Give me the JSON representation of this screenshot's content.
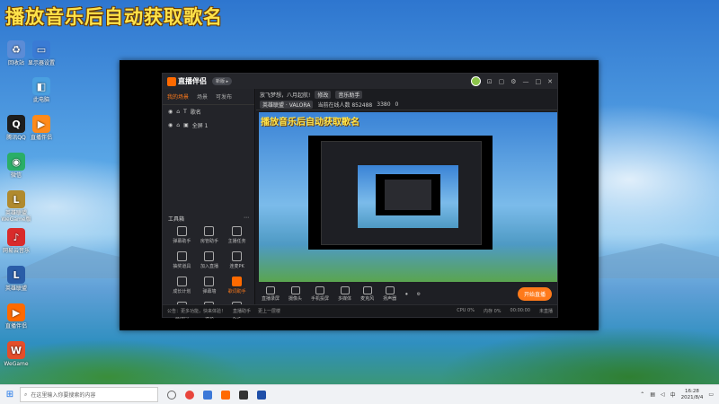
{
  "headline": "播放音乐后自动获取歌名",
  "desktop_icons": [
    {
      "label": "回收站",
      "icon": "recycle-icon",
      "color": "#5b8cd6"
    },
    {
      "label": "腾讯QQ",
      "icon": "qq-icon",
      "color": "#1e1e1e"
    },
    {
      "label": "微信",
      "icon": "wechat-icon",
      "color": "#2aae67"
    },
    {
      "label": "英雄联盟 WeGame版",
      "icon": "lol-icon",
      "color": "#b08a2e"
    },
    {
      "label": "网易云音乐",
      "icon": "netease-music-icon",
      "color": "#d92b2b"
    },
    {
      "label": "英雄联盟",
      "icon": "lol-icon-2",
      "color": "#2a5da8"
    },
    {
      "label": "直播伴侣",
      "icon": "live-companion-icon",
      "color": "#ff6a00"
    },
    {
      "label": "WeGame",
      "icon": "wegame-icon",
      "color": "#e44e2a"
    }
  ],
  "desktop_icons_col2": [
    {
      "label": "显示器设置",
      "icon": "display-icon",
      "color": "#3a7bd5"
    },
    {
      "label": "此电脑",
      "icon": "computer-icon",
      "color": "#4aa0e0"
    },
    {
      "label": "直播伴侣",
      "icon": "live-companion-icon-2",
      "color": "#ff8a1a"
    }
  ],
  "app": {
    "logo": "直播伴侣",
    "version": "新版 ▸",
    "tabs": [
      "我的场景",
      "场景",
      "可发布"
    ],
    "scene_items": [
      "歌名",
      "全屏 1"
    ],
    "tools_header": "工具箱",
    "tools": [
      {
        "label": "弹幕助手",
        "hot": false
      },
      {
        "label": "房管助手",
        "hot": false
      },
      {
        "label": "主播任务",
        "hot": false
      },
      {
        "label": "抽奖道具",
        "hot": false
      },
      {
        "label": "加入直播",
        "hot": false
      },
      {
        "label": "连麦PK",
        "hot": false
      },
      {
        "label": "成长计划",
        "hot": false
      },
      {
        "label": "弹幕墙",
        "hot": false
      },
      {
        "label": "歌词助手",
        "hot": true
      },
      {
        "label": "直播间",
        "hot": false
      },
      {
        "label": "模板",
        "hot": false
      },
      {
        "label": "更多",
        "hot": false
      }
    ],
    "info": {
      "title": "放飞梦想，八月起航!",
      "edit_label": "修改",
      "category": "音乐助手",
      "row2": [
        "英雄联盟 · VALORA",
        "当前在线人数 852488",
        "3380",
        "0"
      ]
    },
    "preview_title": "播放音乐后自动获取歌名",
    "bottom_buttons": [
      "直播录屏",
      "摄像头",
      "手机投屏",
      "多媒体",
      "麦克风",
      "扬声器"
    ],
    "start_button": "开始直播",
    "status_left": [
      "公告：更多功能，快来体验！",
      "直播助手",
      "更上一层楼"
    ],
    "status_right": [
      "CPU 0%",
      "内存 0%",
      "00:00:00",
      "未直播"
    ]
  },
  "taskbar": {
    "search_placeholder": "在这里输入你要搜索的内容",
    "time": "16:28",
    "date": "2021/8/4",
    "lang": "中"
  }
}
